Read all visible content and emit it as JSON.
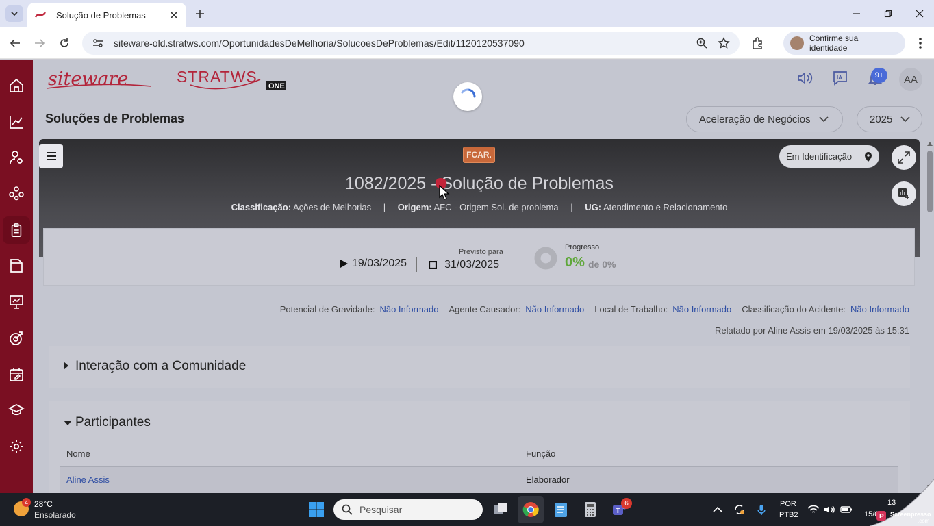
{
  "browser": {
    "tab_title": "Solução de Problemas",
    "url": "siteware-old.stratws.com/OportunidadesDeMelhoria/SolucoesDeProblemas/Edit/1120120537090",
    "identity_label": "Confirme sua identidade"
  },
  "header": {
    "logo_siteware": "siteware",
    "logo_stratws": "STRATWS",
    "logo_one": "ONE",
    "ai_label": "IA",
    "notifications_badge": "9+",
    "avatar_initials": "AA"
  },
  "page": {
    "title": "Soluções de Problemas",
    "unit_select": "Aceleração de Negócios",
    "year_select": "2025"
  },
  "banner": {
    "tag": "FCAR.",
    "status": "Em Identificação",
    "problem_title": "1082/2025 - Solução de Problemas",
    "classificacao_label": "Classificação:",
    "classificacao_value": "Ações de Melhorias",
    "origem_label": "Origem:",
    "origem_value": "AFC - Origem Sol. de problema",
    "ug_label": "UG:",
    "ug_value": "Atendimento e Relacionamento",
    "separator": "|"
  },
  "info": {
    "start_date": "19/03/2025",
    "planned_label": "Previsto para",
    "end_date": "31/03/2025",
    "progress_label": "Progresso",
    "progress_value": "0%",
    "progress_of": "de 0%",
    "progress_fraction": 0
  },
  "fields": {
    "gravidade_label": "Potencial de Gravidade:",
    "gravidade_value": "Não Informado",
    "agente_label": "Agente Causador:",
    "agente_value": "Não Informado",
    "local_label": "Local de Trabalho:",
    "local_value": "Não Informado",
    "acidente_label": "Classificação do Acidente:",
    "acidente_value": "Não Informado",
    "reported": "Relatado por Aline Assis em 19/03/2025 às 15:31"
  },
  "sections": {
    "interacao": "Interação com a Comunidade",
    "participantes": "Participantes",
    "col_nome": "Nome",
    "col_funcao": "Função",
    "rows": [
      {
        "nome": "Aline Assis",
        "funcao": "Elaborador"
      }
    ]
  },
  "taskbar": {
    "weather_badge": "4",
    "temperature": "28°C",
    "condition": "Ensolarado",
    "search_placeholder": "Pesquisar",
    "teams_badge": "6",
    "lang_line1": "POR",
    "lang_line2": "PTB2",
    "clock_line1": "13",
    "clock_line2": "15/0",
    "screenpresso": "Screenpresso",
    "screenpresso_suffix": ".com"
  },
  "colors": {
    "sidebar": "#7a0f22",
    "brand_red": "#b3243a",
    "link_blue": "#2f4ea3",
    "progress_green": "#5fa73a",
    "tag_orange": "#c8683a"
  }
}
